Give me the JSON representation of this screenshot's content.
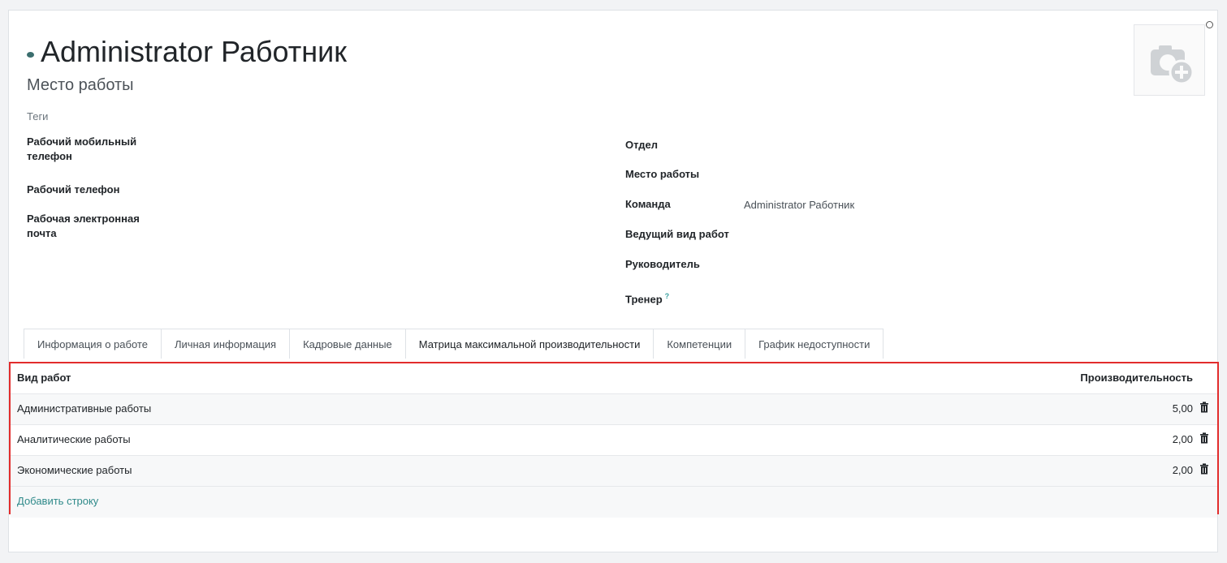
{
  "employee": {
    "name": "Administrator Работник",
    "job_title_placeholder": "Место работы",
    "tags_placeholder": "Теги"
  },
  "left_fields": [
    {
      "label_line1": "Рабочий мобильный",
      "label_line2": "телефон"
    },
    {
      "label_line1": "Рабочий телефон",
      "label_line2": ""
    },
    {
      "label_line1": "Рабочая электронная",
      "label_line2": "почта"
    }
  ],
  "right_fields": {
    "department": "Отдел",
    "work_location": "Место работы",
    "team_label": "Команда",
    "team_value": "Administrator Работник",
    "lead_work_type": "Ведущий вид работ",
    "manager": "Руководитель",
    "coach": "Тренер",
    "coach_help": "?"
  },
  "tabs": [
    {
      "label": "Информация о работе"
    },
    {
      "label": "Личная информация"
    },
    {
      "label": "Кадровые данные"
    },
    {
      "label": "Матрица максимальной производительности",
      "active": true
    },
    {
      "label": "Компетенции"
    },
    {
      "label": "График недоступности"
    }
  ],
  "matrix": {
    "header_work_type": "Вид работ",
    "header_productivity": "Производительность",
    "rows": [
      {
        "work_type": "Административные работы",
        "productivity": "5,00"
      },
      {
        "work_type": "Аналитические работы",
        "productivity": "2,00"
      },
      {
        "work_type": "Экономические работы",
        "productivity": "2,00"
      }
    ],
    "add_line": "Добавить строку"
  },
  "colors": {
    "highlight_border": "#e22c2c",
    "link": "#2f8a8a"
  }
}
